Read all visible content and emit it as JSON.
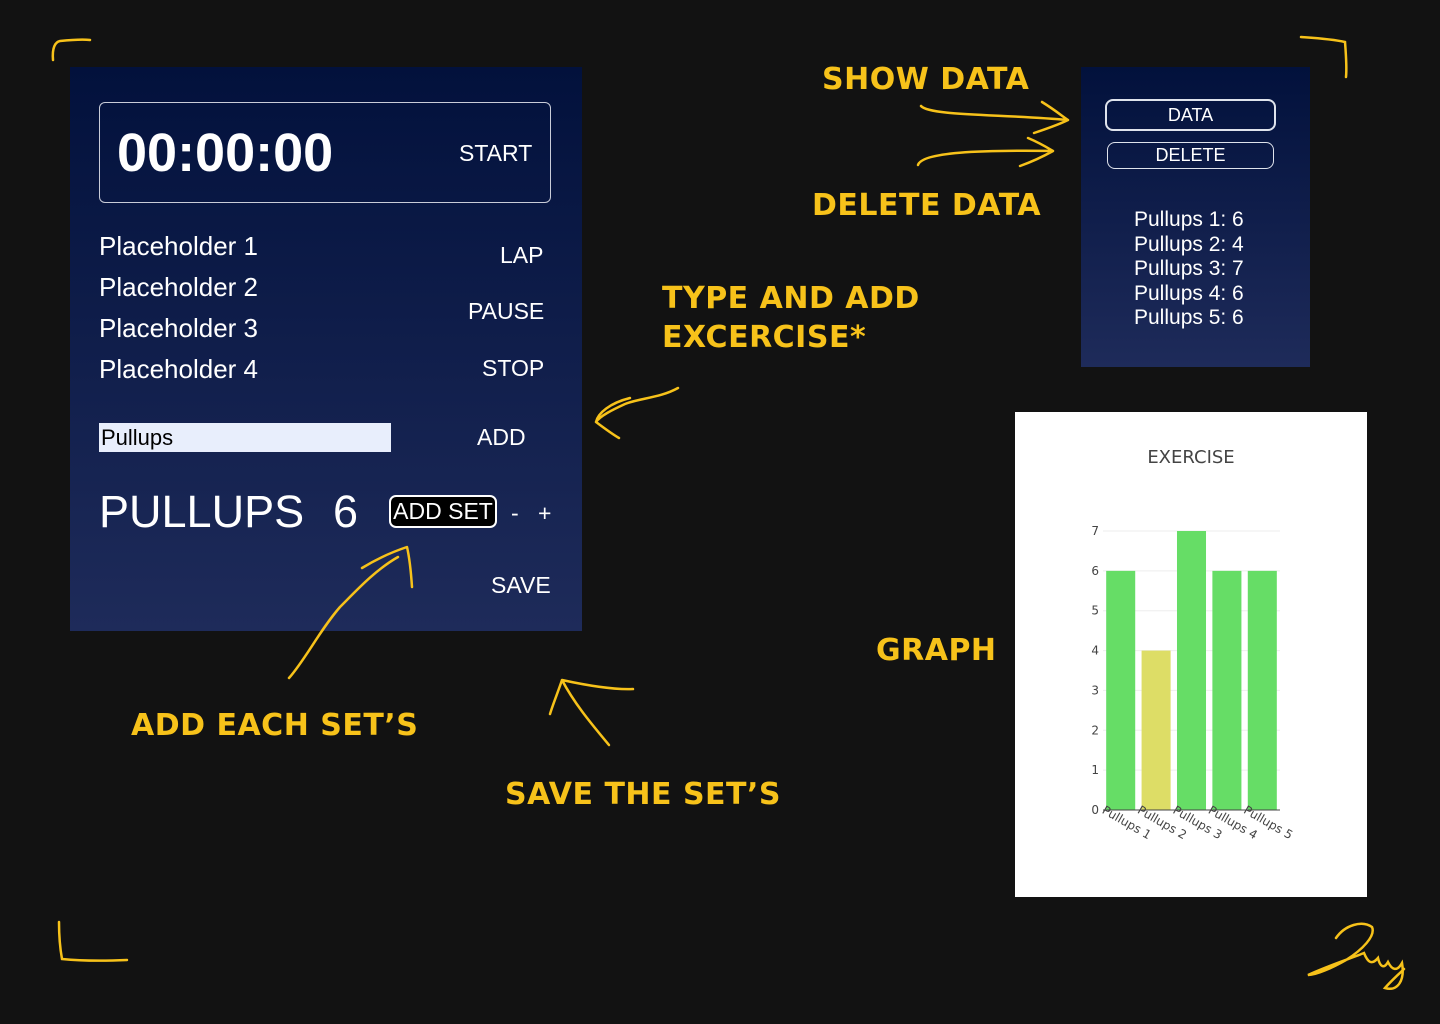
{
  "timer": {
    "display": "00:00:00",
    "start_label": "START"
  },
  "laps": [
    "Placeholder 1",
    "Placeholder 2",
    "Placeholder 3",
    "Placeholder 4"
  ],
  "controls": {
    "lap": "LAP",
    "pause": "PAUSE",
    "stop": "STOP",
    "add": "ADD",
    "save": "SAVE",
    "add_set": "ADD SET",
    "minus": "-",
    "plus": "+"
  },
  "exercise_input": {
    "value": "Pullups"
  },
  "current": {
    "name": "PULLUPS",
    "count": "6"
  },
  "data_panel": {
    "data_label": "DATA",
    "delete_label": "DELETE",
    "entries": [
      "Pullups 1: 6",
      "Pullups 2: 4",
      "Pullups 3: 7",
      "Pullups 4: 6",
      "Pullups 5: 6"
    ]
  },
  "annotations": {
    "show_data": "SHOW DATA",
    "delete_data": "DELETE DATA",
    "type_add_1": "TYPE AND ADD",
    "type_add_2": "EXCERCISE*",
    "add_each": "ADD EACH SET’S",
    "save_sets": "SAVE THE SET’S",
    "graph": "GRAPH"
  },
  "colors": {
    "annotation": "#f7c21a",
    "panel_top": "#02113c",
    "panel_bottom": "#1e2b5a",
    "bar_default": "#66dd66",
    "bar_highlight": "#dddd66"
  },
  "chart_data": {
    "type": "bar",
    "title": "EXERCISE",
    "categories": [
      "Pullups 1",
      "Pullups 2",
      "Pullups 3",
      "Pullups 4",
      "Pullups 5"
    ],
    "values": [
      6,
      4,
      7,
      6,
      6
    ],
    "bar_colors": [
      "#66dd66",
      "#dddd66",
      "#66dd66",
      "#66dd66",
      "#66dd66"
    ],
    "ylim": [
      0,
      7
    ],
    "yticks": [
      0,
      1,
      2,
      3,
      4,
      5,
      6,
      7
    ],
    "xlabel": "",
    "ylabel": "",
    "grid": true
  }
}
